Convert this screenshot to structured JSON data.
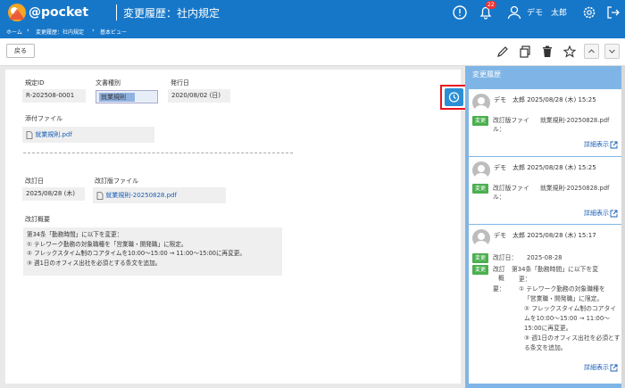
{
  "header": {
    "logo_text": "@pocket",
    "page_heading": "変更履歴：社内規定",
    "notification_count": "22",
    "user_name": "デモ　太郎"
  },
  "breadcrumb": [
    "ホーム",
    "変更履歴：社内規定",
    "基本ビュー"
  ],
  "toolbar": {
    "back_label": "戻る"
  },
  "form": {
    "rule_id_label": "規定ID",
    "rule_id": "R-202508-0001",
    "doc_type_label": "文書種別",
    "doc_type": "就業規則",
    "issue_date_label": "発行日",
    "issue_date": "2020/08/02 (日)",
    "attachment_label": "添付ファイル",
    "attachment": "就業規則.pdf",
    "revision_date_label": "改訂日",
    "revision_date": "2025/08/28 (木)",
    "revision_file_label": "改訂版ファイル",
    "revision_file": "就業規則-20250828.pdf",
    "summary_label": "改訂概要",
    "summary_lines": [
      "第34条「勤務時間」に以下を変更：",
      "① テレワーク勤務の対象職種を「営業職・開発職」に限定。",
      "② フレックスタイム制のコアタイムを10:00〜15:00 → 11:00〜15:00に再変更。",
      "③ 週1日のオフィス出社を必須とする条文を追加。"
    ]
  },
  "history_panel": {
    "title": "変更履歴",
    "detail_label": "詳細表示",
    "entries": [
      {
        "user_time": "デモ　太郎 2025/08/28 (木) 15:25",
        "tag": "変更",
        "field": "改訂版ファイ",
        "field2": "ル：",
        "value": "就業規則-20250828.pdf"
      },
      {
        "user_time": "デモ　太郎 2025/08/28 (木) 15:25",
        "tag": "変更",
        "field": "改訂版ファイ",
        "field2": "ル：",
        "value": "就業規則-20250828.pdf"
      },
      {
        "user_time": "デモ　太郎 2025/08/28 (木) 15:17",
        "tag1": "変更",
        "row1_field": "改訂日：",
        "row1_value": "2025-08-28",
        "tag2": "変更",
        "row2_field_a": "改訂",
        "row2_field_b": "概",
        "row2_field_c": "要：",
        "row2_lines": [
          "第34条「勤務時間」に以下を変",
          "更：",
          "① テレワーク勤務の対象職種を",
          "「営業職・開発職」に限定。",
          "② フレックスタイム制のコアタイ",
          "ムを10:00〜15:00 → 11:00〜",
          "15:00に再変更。",
          "③ 週1日のオフィス出社を必須とす",
          "る条文を追加。"
        ]
      }
    ]
  },
  "colors": {
    "header": "#1677c9",
    "panel": "#7fb5e6",
    "tag": "#4caf50",
    "highlight": "#e8141c"
  }
}
